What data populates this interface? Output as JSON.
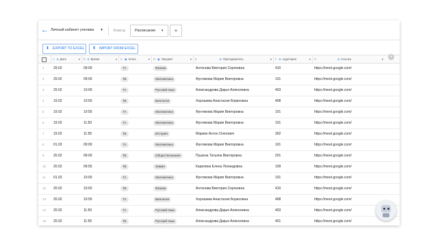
{
  "topbar": {
    "cabinet_title": "Личный кабинет ученика",
    "tab_classes": "Классы",
    "tab_schedule": "Расписание",
    "add_tab": "+"
  },
  "toolbar": {
    "export_label": "EXPORT TO EXCEL",
    "import_label": "IMPORT FROM EXCEL"
  },
  "columns": [
    {
      "letter": "A",
      "title": "Дата"
    },
    {
      "letter": "B",
      "title": "Время"
    },
    {
      "letter": "C",
      "title": "Класс"
    },
    {
      "letter": "D",
      "title": "Предмет"
    },
    {
      "letter": "E",
      "title": "Преподаватель"
    },
    {
      "letter": "F",
      "title": "Аудитория"
    },
    {
      "letter": "G",
      "title": "Ссылка"
    }
  ],
  "rows": [
    {
      "n": "1",
      "date": "29.02",
      "time": "09:00",
      "cls": "7А",
      "subject": "Физика",
      "teacher": "Антонова Виктория Сергеевна",
      "room": "410",
      "link": "https://meet.google.com/"
    },
    {
      "n": "2",
      "date": "29.02",
      "time": "09:00",
      "cls": "7Б",
      "subject": "Математика",
      "teacher": "Фунтикова Мария Викторовна",
      "room": "101",
      "link": "https://meet.google.com/"
    },
    {
      "n": "3",
      "date": "29.02",
      "time": "10:00",
      "cls": "7А",
      "subject": "Русский язык",
      "teacher": "Александрова Дарья Алексеевна",
      "room": "403",
      "link": "https://meet.google.com/"
    },
    {
      "n": "4",
      "date": "19.02",
      "time": "10:50",
      "cls": "7Б",
      "subject": "Биология",
      "teacher": "Хорошева Анастасия Борисовна",
      "room": "408",
      "link": "https://meet.google.com/"
    },
    {
      "n": "5",
      "date": "19.02",
      "time": "10:55",
      "cls": "7А",
      "subject": "Математика",
      "teacher": "Фунтикова Мария Викторовна",
      "room": "101",
      "link": "https://meet.google.com/"
    },
    {
      "n": "6",
      "date": "19.02",
      "time": "11:50",
      "cls": "7А",
      "subject": "Математика",
      "teacher": "Фунтикова Мария Викторовна",
      "room": "101",
      "link": "https://meet.google.com/"
    },
    {
      "n": "7",
      "date": "19.02",
      "time": "11:55",
      "cls": "7Б",
      "subject": "История",
      "teacher": "Маркин Антон Олегович",
      "room": "302",
      "link": "https://meet.google.com/"
    },
    {
      "n": "8",
      "date": "01.03",
      "time": "09:00",
      "cls": "7А",
      "subject": "Математика",
      "teacher": "Фунтикова Мария Викторовна",
      "room": "101",
      "link": "https://meet.google.com/"
    },
    {
      "n": "9",
      "date": "20.02",
      "time": "09:00",
      "cls": "7Б",
      "subject": "Обществознание",
      "teacher": "Пушена Татьяна Викторовна",
      "room": "201",
      "link": "https://meet.google.com/"
    },
    {
      "n": "10",
      "date": "20.02",
      "time": "09:55",
      "cls": "7Б",
      "subject": "Химия",
      "teacher": "Карелина Елена Леонидовна",
      "room": "109",
      "link": "https://meet.google.com/"
    },
    {
      "n": "11",
      "date": "01.03",
      "time": "10:00",
      "cls": "7А",
      "subject": "Математика",
      "teacher": "Фунтикова Мария Викторовна",
      "room": "101",
      "link": "https://meet.google.com/"
    },
    {
      "n": "12",
      "date": "20.02",
      "time": "10:50",
      "cls": "7Б",
      "subject": "Физика",
      "teacher": "Антонова Виктория Сергеевна",
      "room": "410",
      "link": "https://meet.google.com/"
    },
    {
      "n": "13",
      "date": "20.02",
      "time": "10:55",
      "cls": "7А",
      "subject": "Биология",
      "teacher": "Хорошева Анастасия Борисовна",
      "room": "408",
      "link": "https://meet.google.com/"
    },
    {
      "n": "14",
      "date": "20.02",
      "time": "11:50",
      "cls": "7А",
      "subject": "Русский язык",
      "teacher": "Александрова Дарья Алексеевна",
      "room": "403",
      "link": "https://meet.google.com/"
    },
    {
      "n": "15",
      "date": "20.02",
      "time": "11:55",
      "cls": "7Б",
      "subject": "Русский язык",
      "teacher": "Александрова Дарья Алексеевна",
      "room": "401",
      "link": "https://meet.google.com/"
    }
  ],
  "colors": {
    "accent": "#1a73e8",
    "pill": "#e8e8e8"
  },
  "icons": {
    "back": "arrow-left-icon",
    "export": "download-icon",
    "import": "upload-icon",
    "assistant": "robot-assistant-icon"
  }
}
